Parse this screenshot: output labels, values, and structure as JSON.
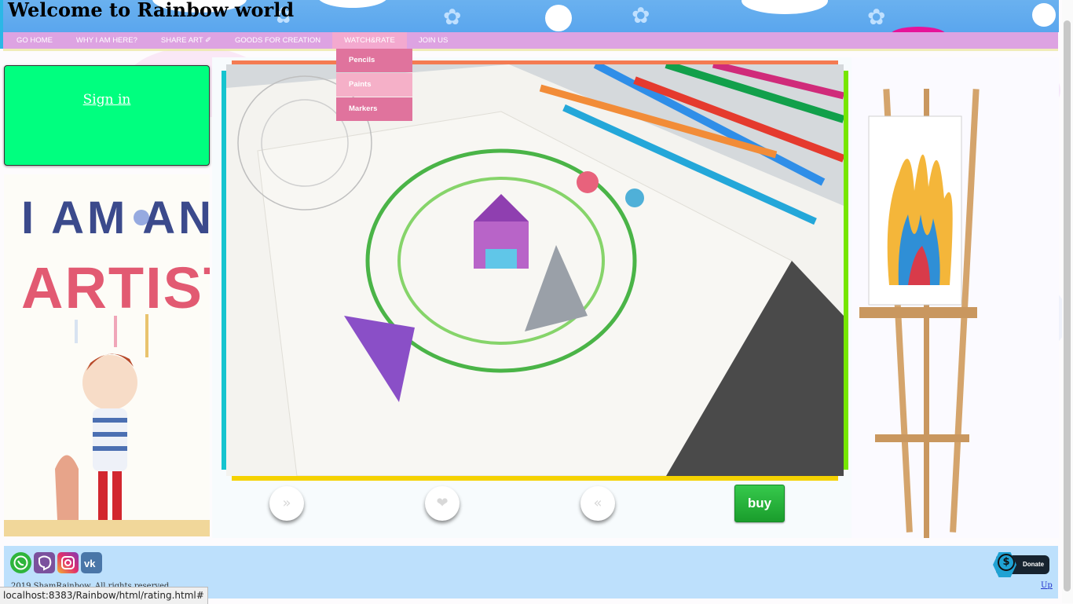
{
  "header": {
    "title": "Welcome to Rainbow world"
  },
  "nav": {
    "items": [
      {
        "label": "GO HOME"
      },
      {
        "label": "WHY I AM HERE?"
      },
      {
        "label": "SHARE ART ✐"
      },
      {
        "label": "GOODS FOR CREATION"
      },
      {
        "label": "WATCH&RATE",
        "active": true
      },
      {
        "label": "JOIN US"
      }
    ],
    "dropdown": [
      "Pencils",
      "Paints",
      "Markers"
    ]
  },
  "sidebar": {
    "signin_label": "Sign in",
    "poster_text_line1": "I AM AN",
    "poster_text_line2": "ARTIST"
  },
  "slider": {
    "next_label": "»",
    "like_label": "❤",
    "prev_label": "«",
    "buy_label": "buy"
  },
  "footer": {
    "social": [
      "whatsapp-icon",
      "viber-icon",
      "instagram-icon",
      "vk-icon"
    ],
    "donate_label": "Donate",
    "up_label": "Up",
    "copyright": "2019 ShamRainbow. All rights reserved"
  },
  "statusbar": {
    "url": "localhost:8383/Rainbow/html/rating.html#"
  },
  "colors": {
    "nav": "#dda3e2",
    "signin": "#00ff7f",
    "footer": "#bde0fc",
    "buy": "#2bb540"
  }
}
